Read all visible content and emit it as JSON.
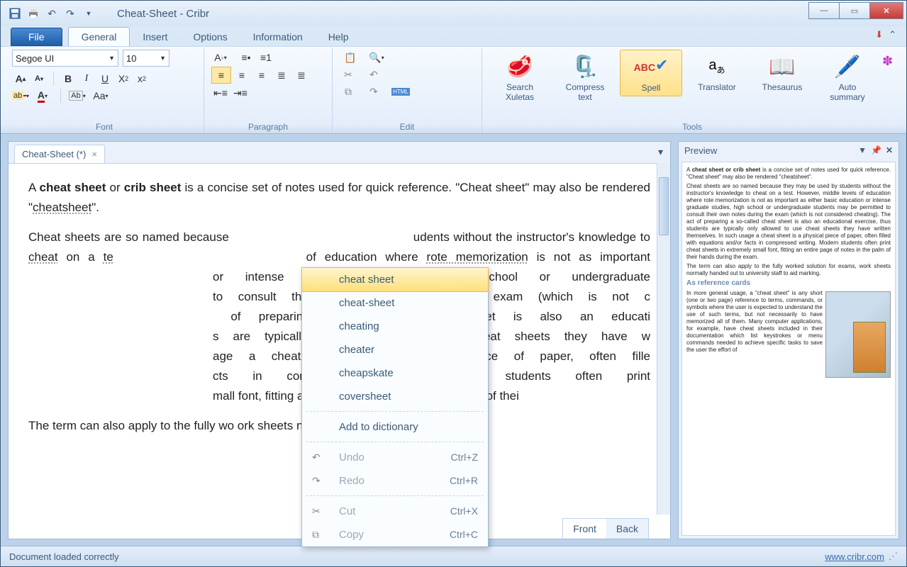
{
  "title": "Cheat-Sheet - Cribr",
  "tabs": {
    "file": "File",
    "general": "General",
    "insert": "Insert",
    "options": "Options",
    "information": "Information",
    "help": "Help"
  },
  "font": {
    "name": "Segoe UI",
    "size": "10"
  },
  "groups": {
    "font": "Font",
    "paragraph": "Paragraph",
    "edit": "Edit",
    "tools": "Tools"
  },
  "tools": {
    "search": "Search\nXuletas",
    "compress": "Compress\ntext",
    "spell": "Spell",
    "translator": "Translator",
    "thesaurus": "Thesaurus",
    "autosum": "Auto\nsummary"
  },
  "doc": {
    "tab": "Cheat-Sheet (*)",
    "para1_a": "A ",
    "para1_b": "cheat sheet",
    "para1_c": " or ",
    "para1_d": "crib sheet",
    "para1_e": " is a concise set of notes used for quick reference. \"Cheat sheet\" may also be rendered \"",
    "para1_f": "cheatsheet",
    "para1_g": "\".",
    "para2_a": "Cheat sheets are so named because",
    "para2_b": "udents without the instructor's knowledge to ",
    "para2_c": "cheat",
    "para2_d": " on a ",
    "para2_e": "te",
    "para2_f": " of education where ",
    "para2_g": "rote memorization",
    "para2_h": " is not as important",
    "para2_i": "or intense graduate studies, high school or undergraduate ",
    "para2_j": "to consult their own notes during the exam (which is not c",
    "para2_k": " of preparing a so-called cheat sheet is also an educati",
    "para2_l": "s are typically only allowed to use cheat sheets they have w",
    "para2_m": "age a cheat sheet is a physical piece of paper, often fille",
    "para2_n": "cts in compressed writing. Modern students often print ",
    "para2_o": "mall font, fitting an entire page of notes in the palm of thei",
    "para3": "The term can also apply to the fully wo                                              ork sheets normally"
  },
  "fronttabs": {
    "front": "Front",
    "back": "Back"
  },
  "context": {
    "s1": "cheat sheet",
    "s2": "cheat-sheet",
    "s3": "cheating",
    "s4": "cheater",
    "s5": "cheapskate",
    "s6": "coversheet",
    "add": "Add to dictionary",
    "undo": "Undo",
    "undo_k": "Ctrl+Z",
    "redo": "Redo",
    "redo_k": "Ctrl+R",
    "cut": "Cut",
    "cut_k": "Ctrl+X",
    "copy": "Copy",
    "copy_k": "Ctrl+C"
  },
  "preview": {
    "title": "Preview",
    "p1_a": "A ",
    "p1_b": "cheat sheet or crib sheet",
    "p1_c": " is a concise set of notes used for quick reference. \"Cheat sheet\" may also be rendered \"cheatsheet\".",
    "p2": "Cheat sheets are so named because they may be used by students without the instructor's knowledge to cheat on a test. However, middle levels of education where rote memorization is not as important as either basic education or intense graduate studies, high school or undergraduate students may be permitted to consult their own notes during the exam (which is not considered cheating). The act of preparing a so-called cheat sheet is also an educational exercise, thus students are typically only allowed to use cheat sheets they have written themselves. In such usage a cheat sheet is a physical piece of paper, often filled with equations and/or facts in compressed writing. Modern students often print cheat sheets in extremely small font, fitting an entire page of notes in the palm of their hands during the exam.",
    "p3": "The term can also apply to the fully worked solution for exams, work sheets normally handed out to university staff to aid marking.",
    "h": "As reference cards",
    "p4": "In more general usage, a \"cheat sheet\" is any short (one or two page) reference to terms, commands, or symbols where the user is expected to understand the use of such terms, but not necessarily to have memorized all of them. Many computer applications, for example, have cheat sheets included in their documentation which list keystrokes or menu commands needed to achieve specific tasks to save the user the effort of"
  },
  "status": "Document loaded correctly",
  "link": "www.cribr.com"
}
